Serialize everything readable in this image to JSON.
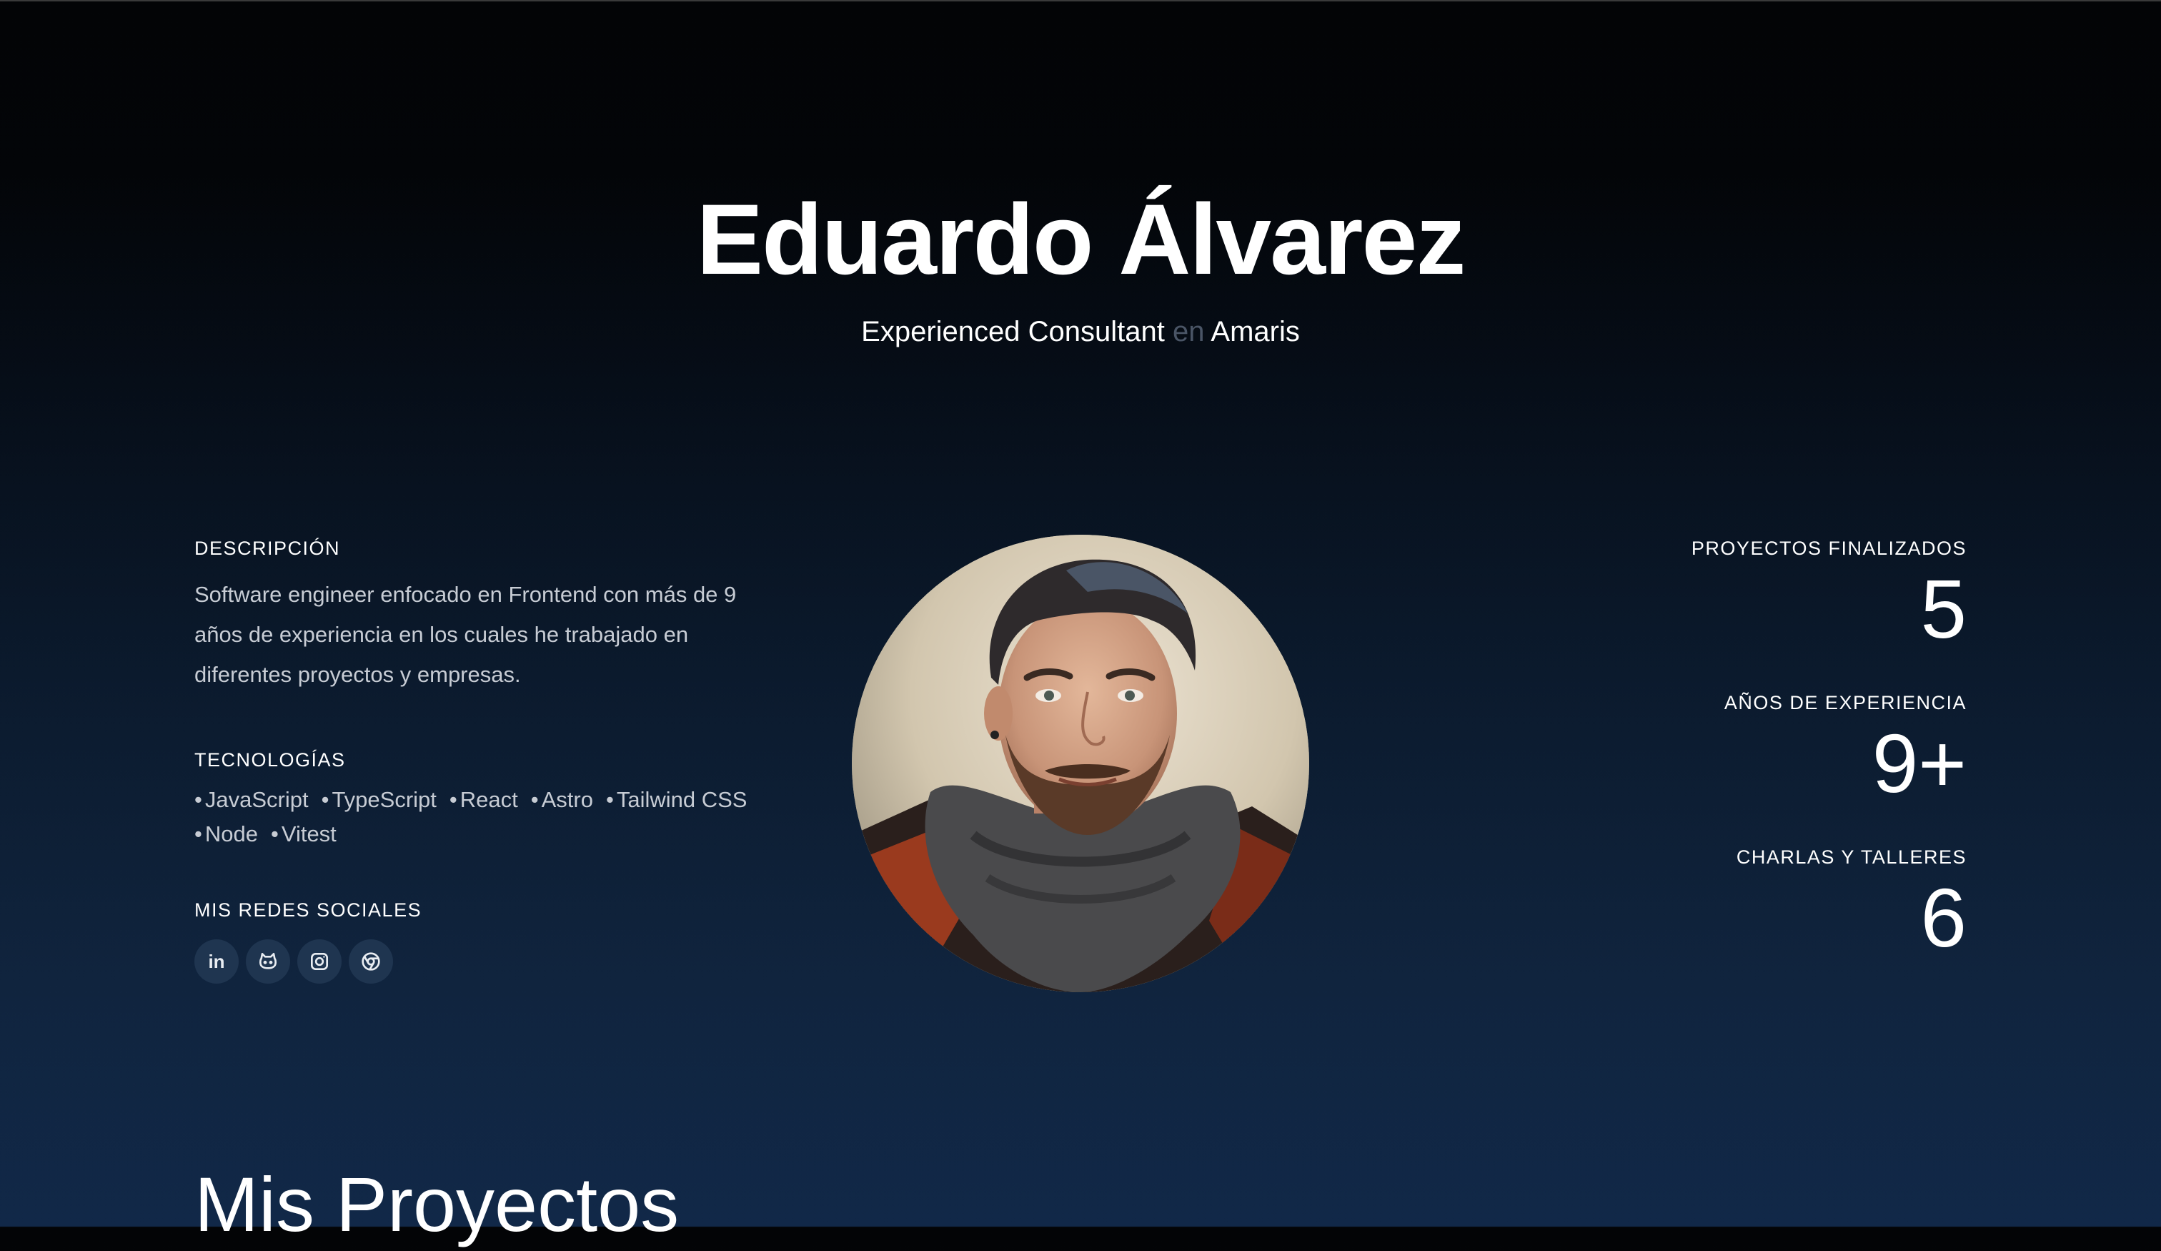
{
  "hero": {
    "name": "Eduardo Álvarez",
    "role": "Experienced Consultant",
    "connector": "en",
    "company": "Amaris"
  },
  "description": {
    "label": "DESCRIPCIÓN",
    "text": "Software engineer enfocado en Frontend con más de 9 años de experiencia en los cuales he trabajado en diferentes proyectos y empresas."
  },
  "technologies": {
    "label": "TECNOLOGÍAS",
    "bullet": "•",
    "items": [
      "JavaScript",
      "TypeScript",
      "React",
      "Astro",
      "Tailwind CSS",
      "Node",
      "Vitest"
    ]
  },
  "social": {
    "label": "MIS REDES SOCIALES",
    "icons": [
      "linkedin-icon",
      "github-icon",
      "instagram-icon",
      "chrome-icon"
    ],
    "linkedin_text": "in"
  },
  "stats": [
    {
      "label": "PROYECTOS FINALIZADOS",
      "value": "5"
    },
    {
      "label": "AÑOS DE EXPERIENCIA",
      "value": "9+"
    },
    {
      "label": "CHARLAS Y TALLERES",
      "value": "6"
    }
  ],
  "projects": {
    "title": "Mis Proyectos"
  },
  "colors": {
    "background_top": "#030406",
    "background_bottom": "#112848",
    "muted_text": "#4a5566",
    "body_text": "#c7ccd4",
    "social_button_bg": "#1f3550"
  }
}
